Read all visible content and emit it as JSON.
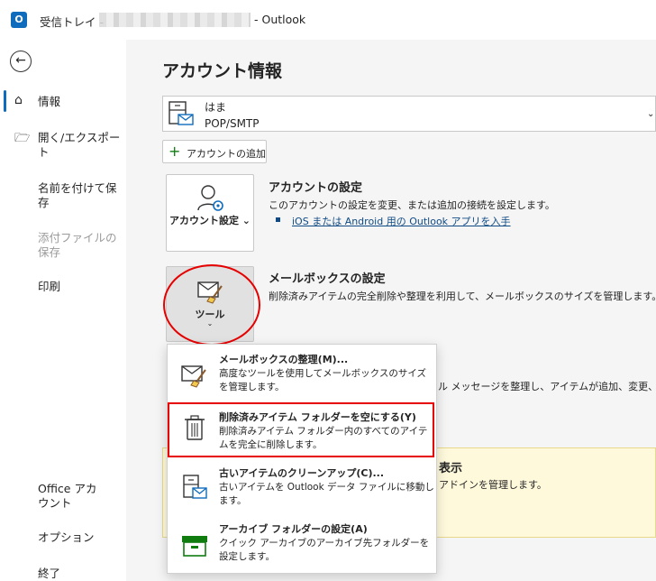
{
  "titlebar": {
    "logo": "O",
    "inbox_label": "受信トレイ -",
    "app_name": "- Outlook"
  },
  "nav": {
    "back_icon": "back-arrow-icon",
    "items": [
      {
        "icon": "⌂",
        "label": "情報"
      },
      {
        "icon": "🗁",
        "label": "開く/エクスポート"
      },
      {
        "label": "名前を付けて保存"
      },
      {
        "label": "添付ファイルの保存"
      },
      {
        "label": "印刷"
      },
      {
        "label": "Office アカウント"
      },
      {
        "label": "オプション"
      },
      {
        "label": "終了"
      }
    ]
  },
  "main": {
    "title": "アカウント情報",
    "account": {
      "name": "はま",
      "type": "POP/SMTP"
    },
    "add_account_label": "アカウントの追加",
    "account_settings": {
      "tile_label": "アカウント設定 ⌄",
      "heading": "アカウントの設定",
      "description": "このアカウントの設定を変更、または追加の接続を設定します。",
      "link": "iOS または Android 用の Outlook アプリを入手"
    },
    "mailbox_settings": {
      "tile_label": "ツール",
      "heading": "メールボックスの設定",
      "description": "削除済みアイテムの完全削除や整理を利用して、メールボックスのサイズを管理します。"
    },
    "partial_text": {
      "rules": "ル メッセージを整理し、アイテムが追加、変更、ま",
      "addins_heading": "表示",
      "addins_desc": "アドインを管理します。"
    }
  },
  "tools_menu": {
    "items": [
      {
        "title": "メールボックスの整理(M)...",
        "desc": "高度なツールを使用してメールボックスのサイズを管理します。"
      },
      {
        "title": "削除済みアイテム フォルダーを空にする(Y)",
        "desc": "削除済みアイテム フォルダー内のすべてのアイテムを完全に削除します。"
      },
      {
        "title": "古いアイテムのクリーンアップ(C)...",
        "desc": "古いアイテムを Outlook データ ファイルに移動します。"
      },
      {
        "title": "アーカイブ フォルダーの設定(A)",
        "desc": "クイック アーカイブのアーカイブ先フォルダーを設定します。"
      }
    ]
  },
  "colors": {
    "accent": "#0f6cbd",
    "highlight": "#e60000",
    "archive_green": "#107c10"
  }
}
